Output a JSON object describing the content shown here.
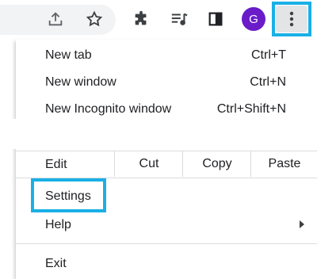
{
  "toolbar": {
    "icons": [
      "share-icon",
      "bookmark-star-icon",
      "extensions-icon",
      "reading-list-icon",
      "side-panel-icon"
    ],
    "avatar_letter": "G",
    "avatar_color": "#6a1cc9",
    "menu_button": "more-options-icon"
  },
  "menu": {
    "new_tab": {
      "label": "New tab",
      "shortcut": "Ctrl+T"
    },
    "new_window": {
      "label": "New window",
      "shortcut": "Ctrl+N"
    },
    "new_incognito": {
      "label": "New Incognito window",
      "shortcut": "Ctrl+Shift+N"
    },
    "edit": {
      "label": "Edit",
      "cut": "Cut",
      "copy": "Copy",
      "paste": "Paste"
    },
    "settings": {
      "label": "Settings"
    },
    "help": {
      "label": "Help"
    },
    "exit": {
      "label": "Exit"
    }
  },
  "highlight_color": "#1ab0e6"
}
